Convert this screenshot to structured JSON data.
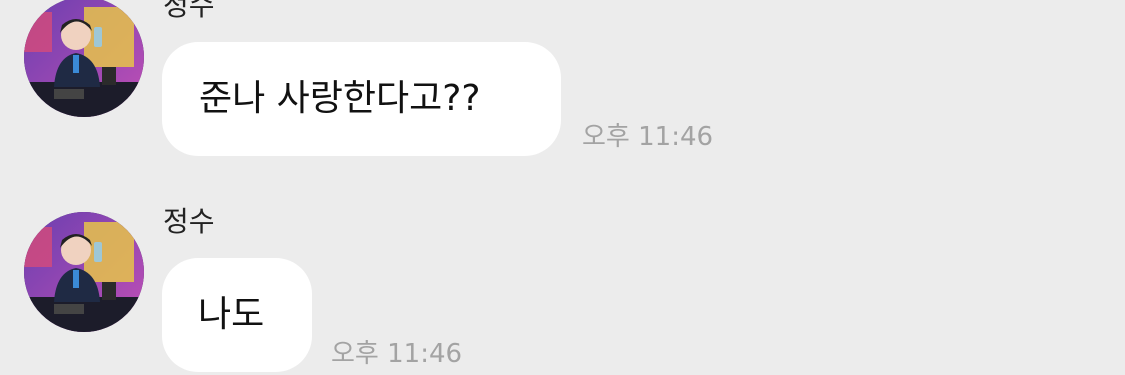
{
  "messages": [
    {
      "sender": "정수",
      "text": "준나 사랑한다고??",
      "time": "오후 11:46",
      "avatar": "profile-photo"
    },
    {
      "sender": "정수",
      "text": "나도",
      "time": "오후 11:46",
      "avatar": "profile-photo"
    }
  ],
  "colors": {
    "background": "#ECECEC",
    "bubble": "#FFFFFF",
    "text": "#111111",
    "timestamp": "#A3A3A3"
  }
}
